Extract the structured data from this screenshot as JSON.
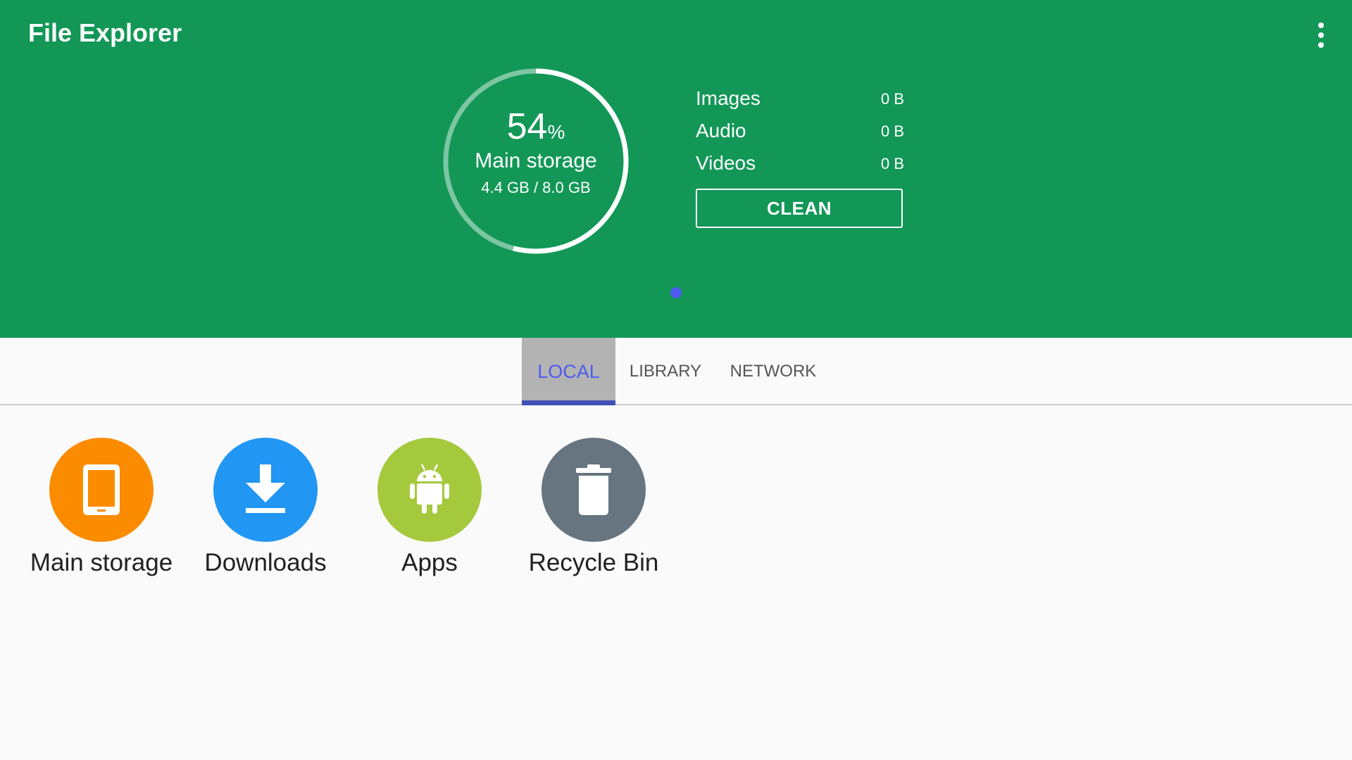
{
  "app": {
    "title": "File Explorer"
  },
  "header": {
    "menu_icon": "more-vert-icon",
    "storage": {
      "percent": "54",
      "percent_sign": "%",
      "percent_value": 0.54,
      "label": "Main storage",
      "usage": "4.4 GB / 8.0 GB"
    },
    "categories": [
      {
        "name": "Images",
        "size": "0 B"
      },
      {
        "name": "Audio",
        "size": "0 B"
      },
      {
        "name": "Videos",
        "size": "0 B"
      }
    ],
    "clean_label": "CLEAN",
    "colors": {
      "background": "#129757",
      "page_indicator": "#4e5bf2"
    }
  },
  "tabs": [
    {
      "label": "LOCAL",
      "active": true
    },
    {
      "label": "LIBRARY",
      "active": false
    },
    {
      "label": "NETWORK",
      "active": false
    }
  ],
  "shortcuts": [
    {
      "label": "Main storage",
      "icon": "tablet-icon",
      "color": "#fb8c00"
    },
    {
      "label": "Downloads",
      "icon": "download-icon",
      "color": "#2196f3"
    },
    {
      "label": "Apps",
      "icon": "android-icon",
      "color": "#a5c93d"
    },
    {
      "label": "Recycle Bin",
      "icon": "trash-icon",
      "color": "#66757f"
    }
  ]
}
